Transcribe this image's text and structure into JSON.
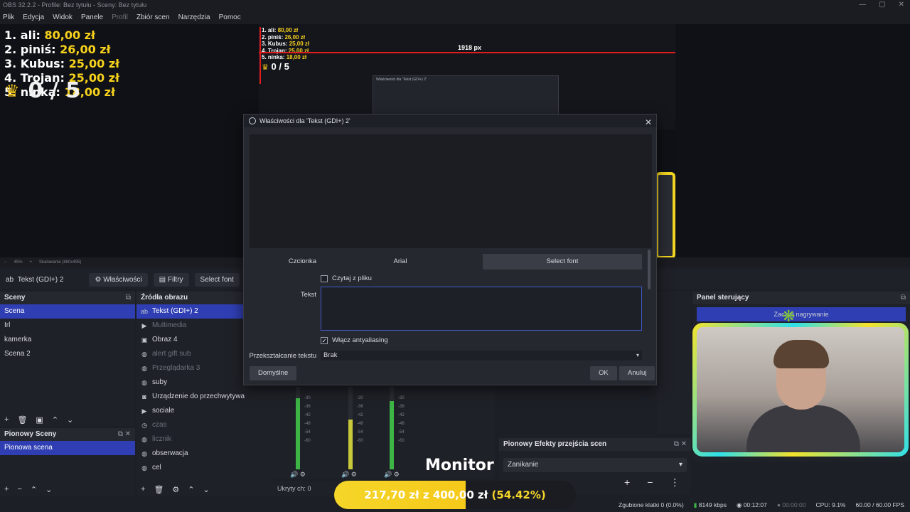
{
  "titlebar": {
    "text": "OBS 32.2.2 - Profile: Bez tytułu - Sceny: Bez tytułu",
    "min": "—",
    "max": "▢",
    "close": "✕"
  },
  "menu": [
    "Plik",
    "Edycja",
    "Widok",
    "Panele",
    "Profil",
    "Zbiór scen",
    "Narzędzia",
    "Pomoc"
  ],
  "overlay": {
    "ranking": [
      {
        "label": "1. ali:",
        "amount": "80,00 zł"
      },
      {
        "label": "2. piniś:",
        "amount": "26,00 zł"
      },
      {
        "label": "3. Kubus:",
        "amount": "25,00 zł"
      },
      {
        "label": "4. Trojan:",
        "amount": "25,00 zł"
      },
      {
        "label": "5. ninka:",
        "amount": "18,00 zł"
      }
    ],
    "counter": "0 / 5",
    "px_label": "1918 px"
  },
  "preview_bar": {
    "zoom": "45%",
    "scale": "Skalowanie (880x495)"
  },
  "source_toolbar": {
    "name": "Tekst (GDI+) 2",
    "properties": "Właściwości",
    "filters": "Filtry",
    "select_font": "Select font"
  },
  "scenes": {
    "title": "Sceny",
    "items": [
      "Scena",
      "Irl",
      "kamerka",
      "Scena 2"
    ]
  },
  "vertical_scenes": {
    "title": "Pionowy Sceny",
    "items": [
      "Pionowa scena"
    ]
  },
  "sources": {
    "title": "Źródła obrazu",
    "items": [
      {
        "name": "Tekst (GDI+) 2",
        "icon": "ab",
        "state": "sel"
      },
      {
        "name": "Multimedia",
        "icon": "▶",
        "state": "dim"
      },
      {
        "name": "Obraz 4",
        "icon": "▣",
        "state": ""
      },
      {
        "name": "alert gift sub",
        "icon": "◍",
        "state": "dim"
      },
      {
        "name": "Przeglądarka 3",
        "icon": "◍",
        "state": "dim"
      },
      {
        "name": "suby",
        "icon": "◍",
        "state": ""
      },
      {
        "name": "Urządzenie do przechwytywa",
        "icon": "◙",
        "state": ""
      },
      {
        "name": "sociale",
        "icon": "▶",
        "state": ""
      },
      {
        "name": "czas",
        "icon": "◷",
        "state": "dim"
      },
      {
        "name": "licznik",
        "icon": "◍",
        "state": "dim"
      },
      {
        "name": "obserwacja",
        "icon": "◍",
        "state": ""
      },
      {
        "name": "cel",
        "icon": "◍",
        "state": ""
      }
    ]
  },
  "mixer": {
    "hidden": "Ukryty ch: 0",
    "ticks": [
      "-30",
      "-36",
      "-42",
      "-48",
      "-54",
      "-60"
    ]
  },
  "transitions": {
    "title": "Pionowy Efekty przejścia scen",
    "value": "Zanikanie"
  },
  "control": {
    "title": "Panel sterujący",
    "button": "Zacznij nagrywanie"
  },
  "donation": {
    "current": "217,70 zł",
    "sep": "z",
    "goal": "400,00 zł",
    "percent": "(54.42%)",
    "progress": 0.5442
  },
  "monitor": "Monitor",
  "status": {
    "dropped": "Zgubione klatki 0 (0.0%)",
    "bitrate": "8149 kbps",
    "live": "00:12:07",
    "rec": "00:00:00",
    "cpu": "CPU: 9.1%",
    "fps": "60.00 / 60.00 FPS"
  },
  "dialog": {
    "title": "Właściwości dla 'Tekst (GDI+) 2'",
    "font_label": "Czcionka",
    "font_value": "Arial",
    "select_font": "Select font",
    "read_file": "Czytaj z pliku",
    "text_label": "Tekst",
    "text_value": "",
    "antialias": "Włącz antyaliasing",
    "transform_label": "Przekształcanie tekstu",
    "transform_value": "Brak",
    "defaults": "Domyślne",
    "ok": "OK",
    "cancel": "Anuluj"
  }
}
